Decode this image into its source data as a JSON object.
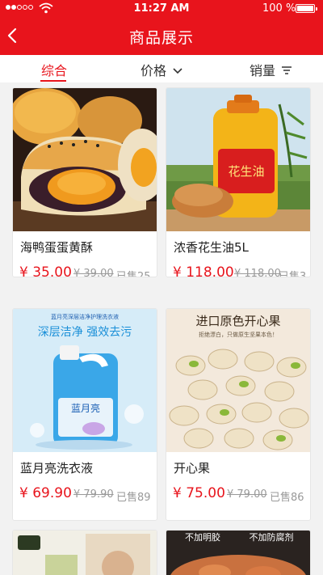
{
  "status": {
    "time": "11:27 AM",
    "battery": "100 %"
  },
  "nav": {
    "title": "商品展示"
  },
  "filters": {
    "comprehensive": "综合",
    "price": "价格",
    "sales": "销量"
  },
  "products": [
    {
      "name": "海鸭蛋蛋黄酥",
      "price": "¥ 35.00",
      "original": "¥ 39.00",
      "sold": "已售25"
    },
    {
      "name": "浓香花生油5L",
      "price": "¥ 118.00",
      "original": "¥ 118.00",
      "sold": "已售3"
    },
    {
      "name": "蓝月亮洗衣液",
      "price": "¥ 69.90",
      "original": "¥ 79.90",
      "sold": "已售89"
    },
    {
      "name": "开心果",
      "price": "¥ 75.00",
      "original": "¥ 79.00",
      "sold": "已售86"
    }
  ],
  "image_text": {
    "oil_label": "花生油",
    "detergent_banner": "深层洁净  强效去污",
    "detergent_top": "蓝月亮深层洁净护理洗衣液",
    "detergent_brand": "蓝月亮",
    "pistachio_title": "进口原色开心果",
    "pistachio_sub": "拒绝漂白，只做原生坚果本色！",
    "banner4a": "不加明胶",
    "banner4b": "不加防腐剂"
  },
  "colors": {
    "brand": "#e8141c",
    "background": "#f2f2f2"
  }
}
